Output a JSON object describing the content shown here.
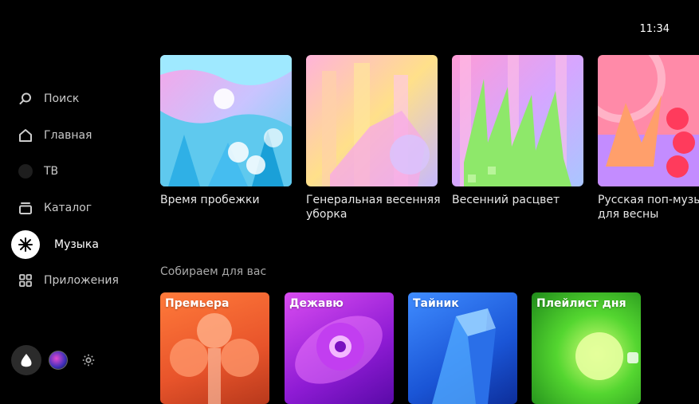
{
  "clock": "11:34",
  "sidebar": {
    "items": [
      {
        "label": "Поиск",
        "icon": "search-icon"
      },
      {
        "label": "Главная",
        "icon": "home-icon"
      },
      {
        "label": "ТВ",
        "icon": "tv-icon"
      },
      {
        "label": "Каталог",
        "icon": "catalog-icon"
      },
      {
        "label": "Музыка",
        "icon": "music-icon"
      },
      {
        "label": "Приложения",
        "icon": "apps-icon"
      }
    ],
    "active": "Музыка"
  },
  "playlists": [
    {
      "title": "Время пробежки"
    },
    {
      "title": "Генеральная весенняя\nуборка"
    },
    {
      "title": "Весенний расцвет"
    },
    {
      "title": "Русская поп-музыка\nдля весны"
    }
  ],
  "section": {
    "title": "Собираем для вас"
  },
  "tiles": [
    {
      "label": "Премьера",
      "color": "#e8642b"
    },
    {
      "label": "Дежавю",
      "color": "#b020d8"
    },
    {
      "label": "Тайник",
      "color": "#1f6be0"
    },
    {
      "label": "Плейлист дня",
      "color": "#3ec22a"
    }
  ]
}
